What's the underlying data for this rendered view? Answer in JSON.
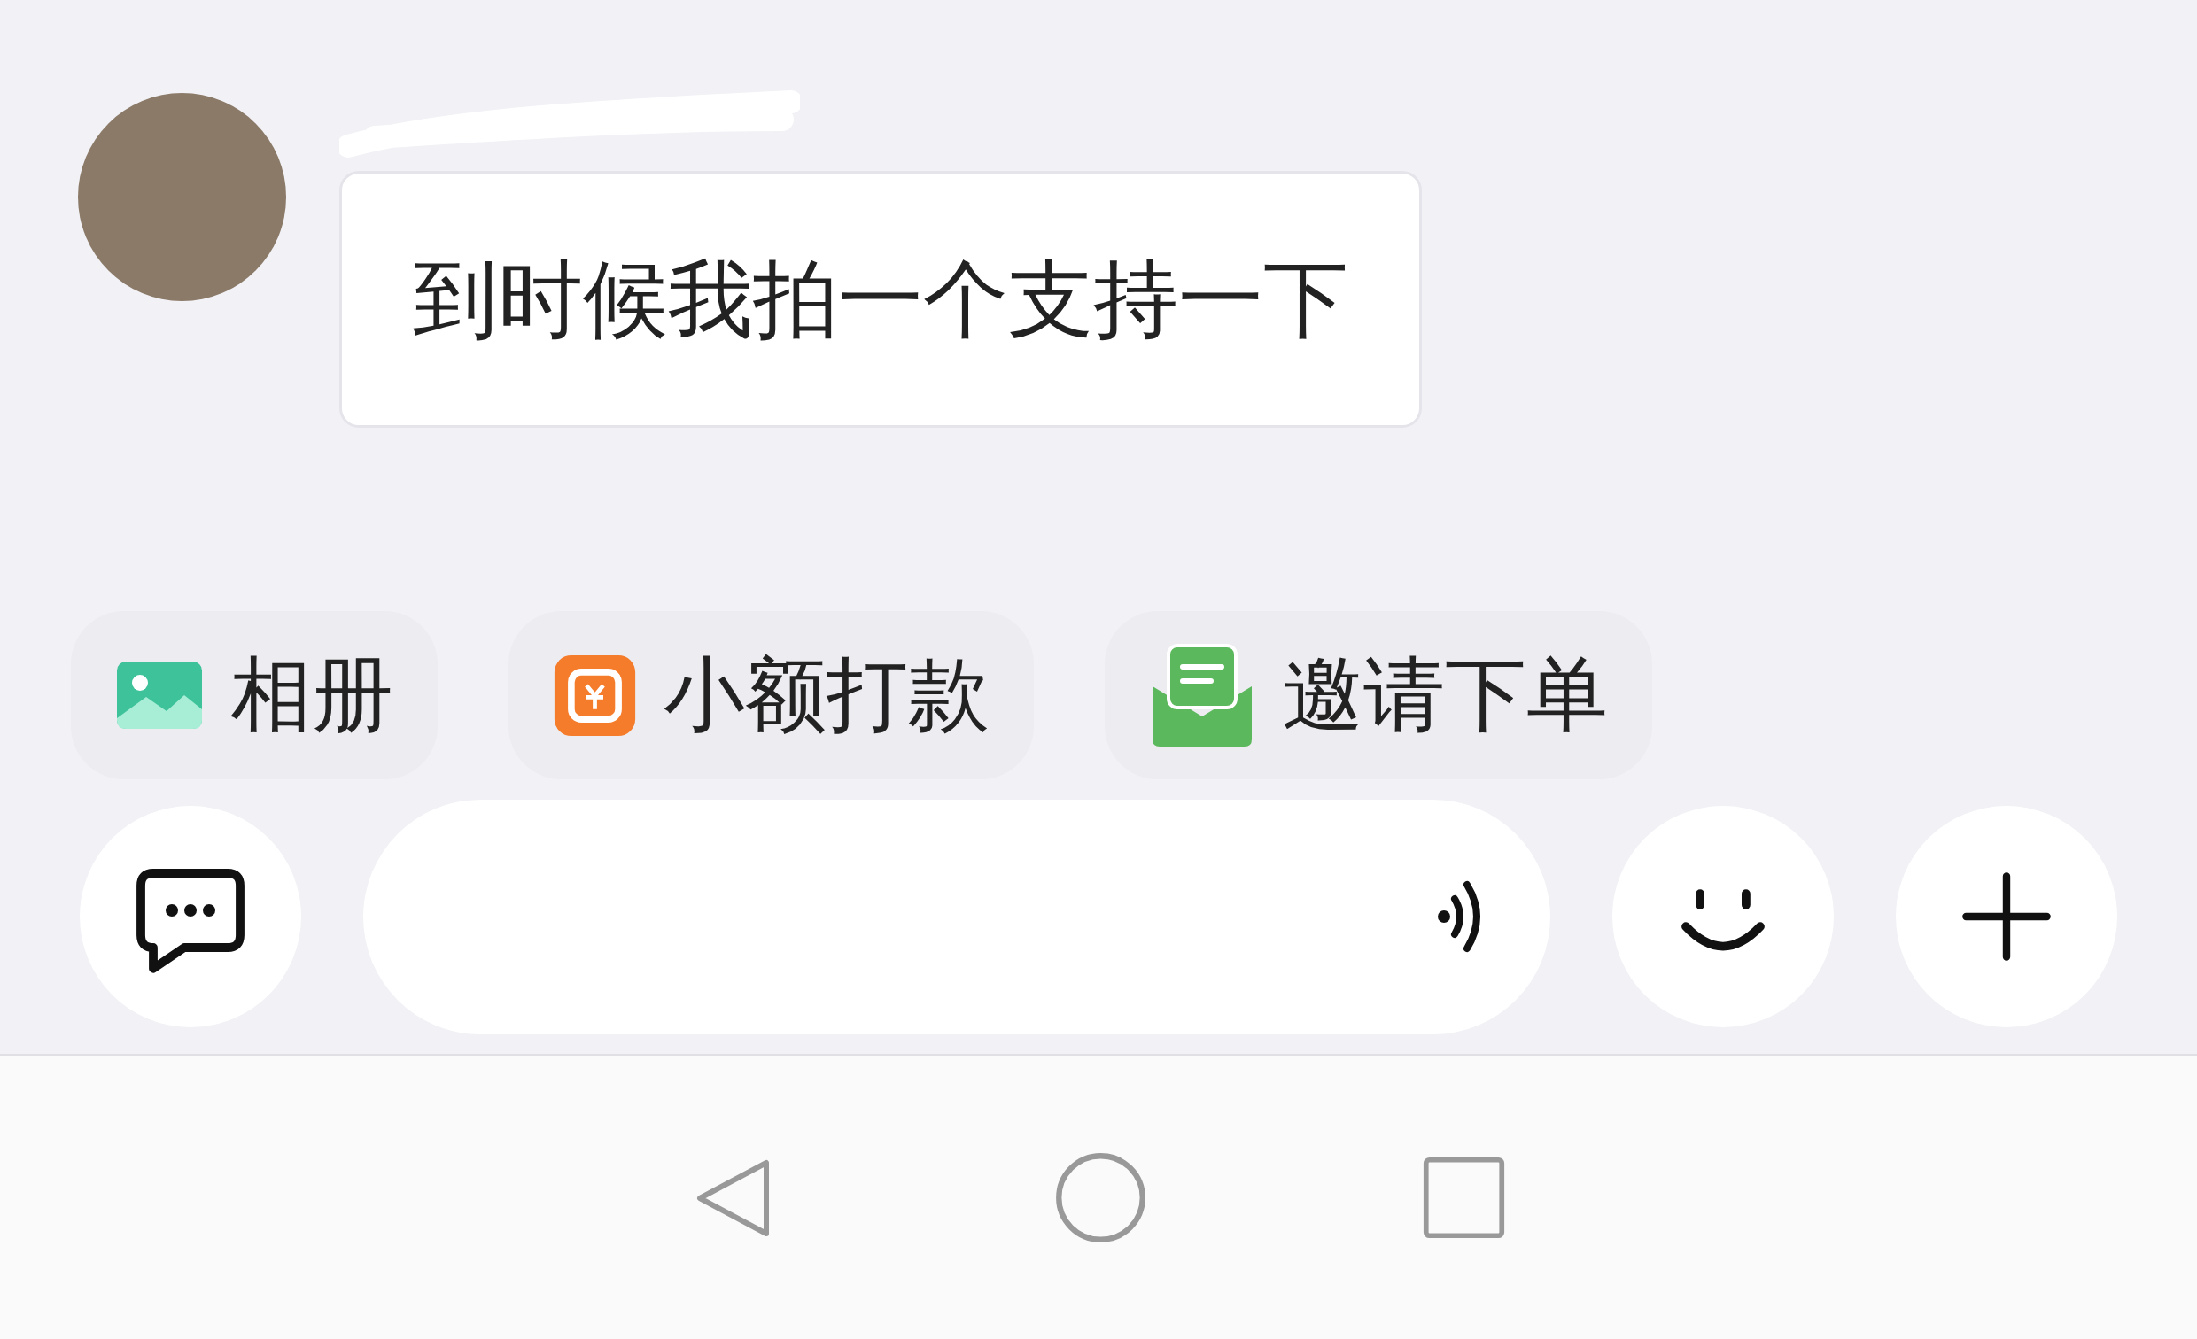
{
  "messages": [
    {
      "text": "到时候我拍一个支持一下"
    }
  ],
  "quick_actions": [
    {
      "kind": "album",
      "label": "相册"
    },
    {
      "kind": "transfer",
      "label": "小额打款"
    },
    {
      "kind": "invite",
      "label": "邀请下单"
    }
  ]
}
